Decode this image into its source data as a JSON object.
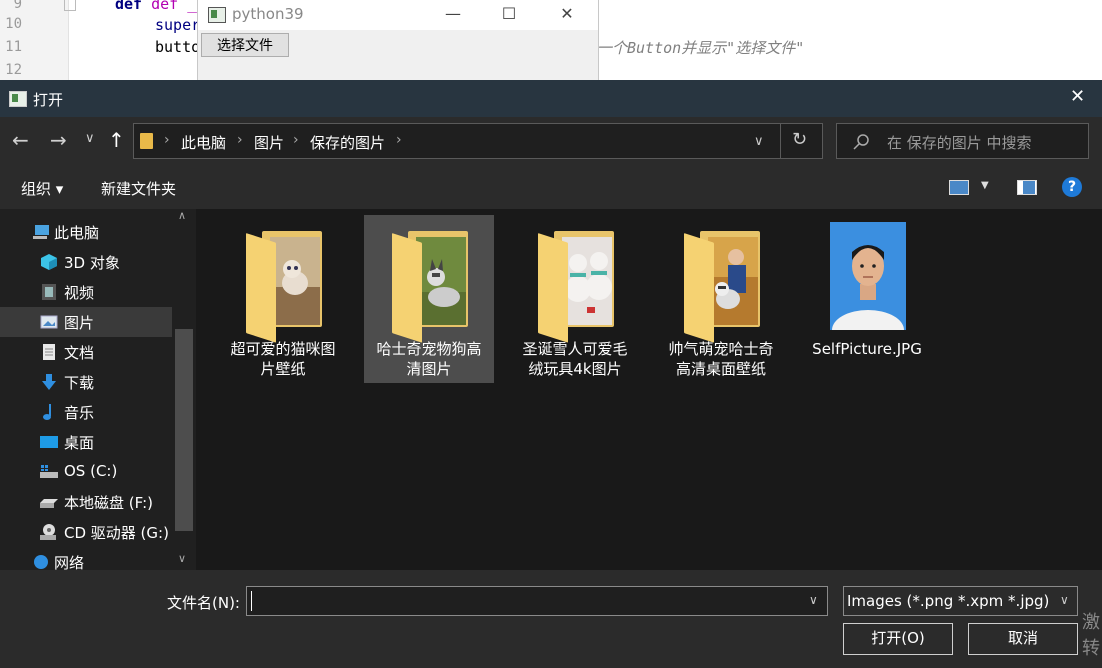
{
  "editor": {
    "lines": [
      {
        "num": "9",
        "code": "def __in"
      },
      {
        "num": "10",
        "code": "super"
      },
      {
        "num": "11",
        "code": "butto"
      },
      {
        "num": "12",
        "code": ""
      }
    ],
    "comment_visible": "一个Button并显示\"选择文件\""
  },
  "pywin": {
    "title": "python39",
    "minimize": "—",
    "maximize": "☐",
    "close": "✕",
    "choose_button": "选择文件"
  },
  "dialog": {
    "title": "打开",
    "close": "✕",
    "nav": {
      "back": "←",
      "forward": "→",
      "recent": "∨",
      "up": "↑",
      "breadcrumb": [
        "此电脑",
        "保存的图片"
      ],
      "crumb_pictures": "图片",
      "crumb_sep": "›",
      "dropdown": "∨",
      "refresh": "↻",
      "search_placeholder": "在 保存的图片 中搜索"
    },
    "toolbar": {
      "organize": "组织 ▾",
      "new_folder": "新建文件夹",
      "help": "?"
    },
    "sidebar": {
      "items": [
        {
          "label": "此电脑",
          "icon": "computer-icon"
        },
        {
          "label": "3D 对象",
          "icon": "cube-icon"
        },
        {
          "label": "视频",
          "icon": "video-icon"
        },
        {
          "label": "图片",
          "icon": "pictures-icon"
        },
        {
          "label": "文档",
          "icon": "document-icon"
        },
        {
          "label": "下载",
          "icon": "download-icon"
        },
        {
          "label": "音乐",
          "icon": "music-icon"
        },
        {
          "label": "桌面",
          "icon": "desktop-icon"
        },
        {
          "label": "OS (C:)",
          "icon": "drive-icon"
        },
        {
          "label": "本地磁盘 (F:)",
          "icon": "drive-icon"
        },
        {
          "label": "CD 驱动器 (G:)",
          "icon": "cd-drive-icon"
        },
        {
          "label": "网络",
          "icon": "network-icon"
        }
      ],
      "selected": "图片",
      "scroll_up": "∧",
      "scroll_down": "∨"
    },
    "files": [
      {
        "name": "超可爱的猫咪图片壁纸",
        "type": "folder",
        "photo": "cat"
      },
      {
        "name": "哈士奇宠物狗高清图片",
        "type": "folder",
        "photo": "husky",
        "selected": true
      },
      {
        "name": "圣诞雪人可爱毛绒玩具4k图片",
        "type": "folder",
        "photo": "snowman"
      },
      {
        "name": "帅气萌宠哈士奇高清桌面壁纸",
        "type": "folder",
        "photo": "girl-husky"
      },
      {
        "name": "SelfPicture.JPG",
        "type": "image",
        "photo": "portrait"
      }
    ],
    "footer": {
      "filename_label": "文件名(N):",
      "filename_value": "",
      "filetype": "Images (*.png *.xpm *.jpg)",
      "open_button": "打开(O)",
      "cancel_button": "取消",
      "watermark": "激\n转"
    },
    "colors": {
      "title_bar": "#283540",
      "background": "#191919",
      "accent": "#0078d7"
    }
  }
}
